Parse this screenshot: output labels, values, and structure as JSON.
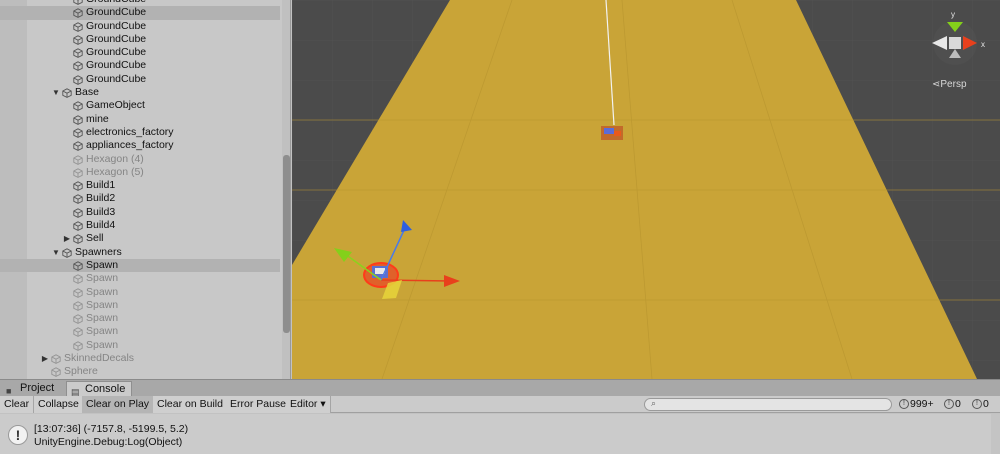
{
  "hierarchy": {
    "rows": [
      {
        "label": "GroundCube",
        "depth": 2,
        "arrow": "",
        "dim": false,
        "selected": false
      },
      {
        "label": "GroundCube",
        "depth": 2,
        "arrow": "",
        "dim": false,
        "selected": true
      },
      {
        "label": "GroundCube",
        "depth": 2,
        "arrow": "",
        "dim": false,
        "selected": false
      },
      {
        "label": "GroundCube",
        "depth": 2,
        "arrow": "",
        "dim": false,
        "selected": false
      },
      {
        "label": "GroundCube",
        "depth": 2,
        "arrow": "",
        "dim": false,
        "selected": false
      },
      {
        "label": "GroundCube",
        "depth": 2,
        "arrow": "",
        "dim": false,
        "selected": false
      },
      {
        "label": "GroundCube",
        "depth": 2,
        "arrow": "",
        "dim": false,
        "selected": false
      },
      {
        "label": "Base",
        "depth": 1,
        "arrow": "▼",
        "dim": false,
        "selected": false
      },
      {
        "label": "GameObject",
        "depth": 2,
        "arrow": "",
        "dim": false,
        "selected": false
      },
      {
        "label": "mine",
        "depth": 2,
        "arrow": "",
        "dim": false,
        "selected": false
      },
      {
        "label": "electronics_factory",
        "depth": 2,
        "arrow": "",
        "dim": false,
        "selected": false
      },
      {
        "label": "appliances_factory",
        "depth": 2,
        "arrow": "",
        "dim": false,
        "selected": false
      },
      {
        "label": "Hexagon (4)",
        "depth": 2,
        "arrow": "",
        "dim": true,
        "selected": false
      },
      {
        "label": "Hexagon (5)",
        "depth": 2,
        "arrow": "",
        "dim": true,
        "selected": false
      },
      {
        "label": "Build1",
        "depth": 2,
        "arrow": "",
        "dim": false,
        "selected": false
      },
      {
        "label": "Build2",
        "depth": 2,
        "arrow": "",
        "dim": false,
        "selected": false
      },
      {
        "label": "Build3",
        "depth": 2,
        "arrow": "",
        "dim": false,
        "selected": false
      },
      {
        "label": "Build4",
        "depth": 2,
        "arrow": "",
        "dim": false,
        "selected": false
      },
      {
        "label": "Sell",
        "depth": 2,
        "arrow": "▶",
        "dim": false,
        "selected": false
      },
      {
        "label": "Spawners",
        "depth": 1,
        "arrow": "▼",
        "dim": false,
        "selected": false
      },
      {
        "label": "Spawn",
        "depth": 2,
        "arrow": "",
        "dim": false,
        "selected": true
      },
      {
        "label": "Spawn",
        "depth": 2,
        "arrow": "",
        "dim": true,
        "selected": false
      },
      {
        "label": "Spawn",
        "depth": 2,
        "arrow": "",
        "dim": true,
        "selected": false
      },
      {
        "label": "Spawn",
        "depth": 2,
        "arrow": "",
        "dim": true,
        "selected": false
      },
      {
        "label": "Spawn",
        "depth": 2,
        "arrow": "",
        "dim": true,
        "selected": false
      },
      {
        "label": "Spawn",
        "depth": 2,
        "arrow": "",
        "dim": true,
        "selected": false
      },
      {
        "label": "Spawn",
        "depth": 2,
        "arrow": "",
        "dim": true,
        "selected": false
      },
      {
        "label": "SkinnedDecals",
        "depth": 0,
        "arrow": "▶",
        "dim": true,
        "selected": false
      },
      {
        "label": "Sphere",
        "depth": 0,
        "arrow": "",
        "dim": true,
        "selected": false
      }
    ]
  },
  "scene": {
    "projection_label": "Persp",
    "gizmo_axes": {
      "y": "y",
      "x": "x"
    },
    "ground_color": "#c9a437",
    "grid_color": "#4a4a4a"
  },
  "tabs": {
    "project": "Project",
    "console": "Console"
  },
  "toolbar": {
    "clear": "Clear",
    "collapse": "Collapse",
    "clear_on_play": "Clear on Play",
    "clear_on_build": "Clear on Build",
    "error_pause": "Error Pause",
    "editor": "Editor ▾",
    "search_placeholder": "",
    "count_info": "999+",
    "count_warn": "0",
    "count_error": "0"
  },
  "log": {
    "line1": "[13:07:36] (-7157.8, -5199.5, 5.2)",
    "line2": "UnityEngine.Debug:Log(Object)"
  }
}
